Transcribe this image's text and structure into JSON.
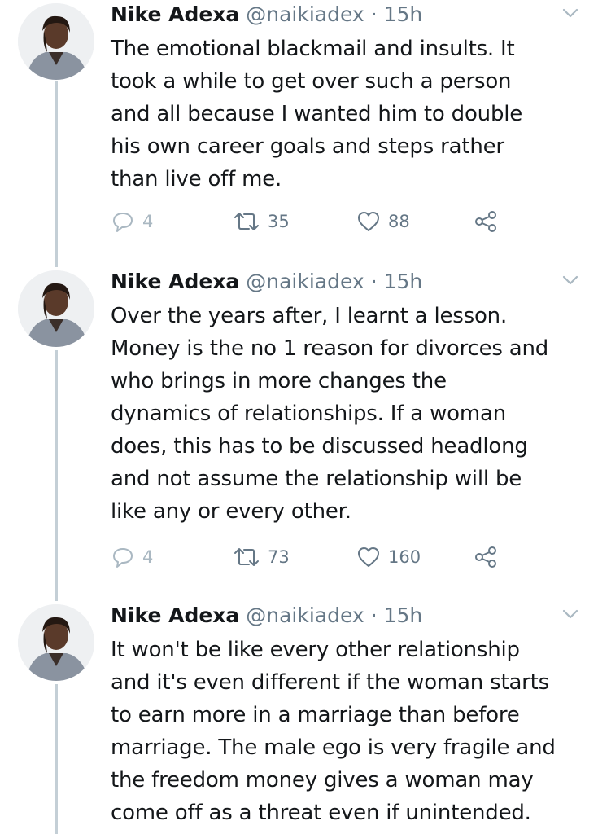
{
  "tweets": [
    {
      "name": "Nike Adexa",
      "handle": "@naikiadex",
      "separator": "·",
      "time": "15h",
      "text": "The emotional blackmail and insults. It\ntook a while to get over such a person\nand all because I wanted him to double\nhis own career goals and steps rather\nthan live off me.",
      "replies": "4",
      "retweets": "35",
      "likes": "88"
    },
    {
      "name": "Nike Adexa",
      "handle": "@naikiadex",
      "separator": "·",
      "time": "15h",
      "text": "Over the years after, I learnt a lesson.\nMoney is the no 1 reason for divorces and\nwho brings in more changes the\ndynamics of relationships. If a woman\ndoes, this has to be discussed headlong\nand not assume the relationship will be\nlike any or every other.",
      "replies": "4",
      "retweets": "73",
      "likes": "160"
    },
    {
      "name": "Nike Adexa",
      "handle": "@naikiadex",
      "separator": "·",
      "time": "15h",
      "text": "It won't be like every other relationship\nand it's even different if the woman starts\nto earn more in a marriage than before\nmarriage. The male ego is very fragile and\nthe freedom money gives a woman may\ncome off as a threat even if unintended.",
      "replies": "",
      "retweets": "",
      "likes": ""
    }
  ],
  "icons": {
    "reply": "speech-bubble-icon",
    "retweet": "retweet-arrows-icon",
    "like": "heart-icon",
    "share": "share-nodes-icon",
    "menu": "chevron-down-icon"
  },
  "colors": {
    "text": "#14171a",
    "secondary": "#657786",
    "thread_line": "#c4cfd6"
  }
}
